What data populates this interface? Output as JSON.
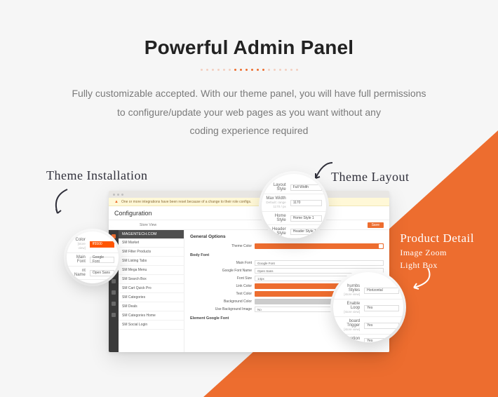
{
  "hero": {
    "title": "Powerful Admin Panel",
    "subtitle_line1": "Fully customizable accepted. With our theme panel, you will have full permissions",
    "subtitle_line2": "to configure/update your web pages as you want without any",
    "subtitle_line3": "coding experience required"
  },
  "handwriting": {
    "install": "Theme Installation",
    "layout": "Theme Layout",
    "detail_title": "Product Detail",
    "detail_sub1": "Image Zoom",
    "detail_sub2": "Light Box"
  },
  "panel": {
    "warn": "One or more integrations have been reset because of a change to their role configs.",
    "config_title": "Configuration",
    "subbar_label": "Store View",
    "save_btn": "Save",
    "side_header": "MAGENTECH.COM",
    "side_items": [
      "SM Market",
      "SM Filter Products",
      "SM Listing Tabs",
      "SM Mega Menu",
      "SM Search Box",
      "SM Cart Quick Pro",
      "SM Categories",
      "SM Deals",
      "SM Categories Home",
      "SM Social Login"
    ],
    "section": "General Options",
    "theme_color_label": "Theme Color",
    "body_font_group": "Body Font",
    "rows": [
      {
        "label": "Main Font",
        "value": "Google Font",
        "type": "inp"
      },
      {
        "label": "Google Font Name",
        "value": "Open Sans",
        "type": "inp"
      },
      {
        "label": "Font Size",
        "value": "14px",
        "type": "inp"
      },
      {
        "label": "Link Color",
        "value": "#444444",
        "type": "sw"
      },
      {
        "label": "Text Color",
        "value": "#666666",
        "type": "sw"
      },
      {
        "label": "Background Color",
        "value": "",
        "type": "swoff"
      },
      {
        "label": "Use Background Image",
        "value": "No",
        "type": "inp"
      }
    ],
    "element_font_group": "Element Google Font"
  },
  "lens_layout": {
    "rows": [
      {
        "label": "Layout Style",
        "value": "Full Width"
      },
      {
        "label": "Max Width",
        "value": "1170",
        "hint": "Default: range 1170 / px"
      },
      {
        "label": "Home Style",
        "value": "Home Style 1"
      },
      {
        "label": "Header Style",
        "value": "Header Style 1"
      }
    ]
  },
  "lens_install": {
    "color_label": "Color",
    "color_value": "ff5500",
    "store_hint": "[store view]",
    "rows": [
      {
        "label": "Main Font",
        "value": "Google Font"
      },
      {
        "label": "nt Name",
        "value": "Open Sans"
      }
    ]
  },
  "lens_detail": {
    "rows": [
      {
        "label": "humbs Styles",
        "hint": "[store view]",
        "value": "Horizontal"
      },
      {
        "label": "Enable Loop",
        "hint": "[store view]",
        "value": "Yes"
      },
      {
        "label": "board Trigger",
        "hint": "[store view]",
        "value": "Yes"
      },
      {
        "label": "vigation",
        "hint": "[store view]",
        "value": "Yes"
      }
    ]
  }
}
